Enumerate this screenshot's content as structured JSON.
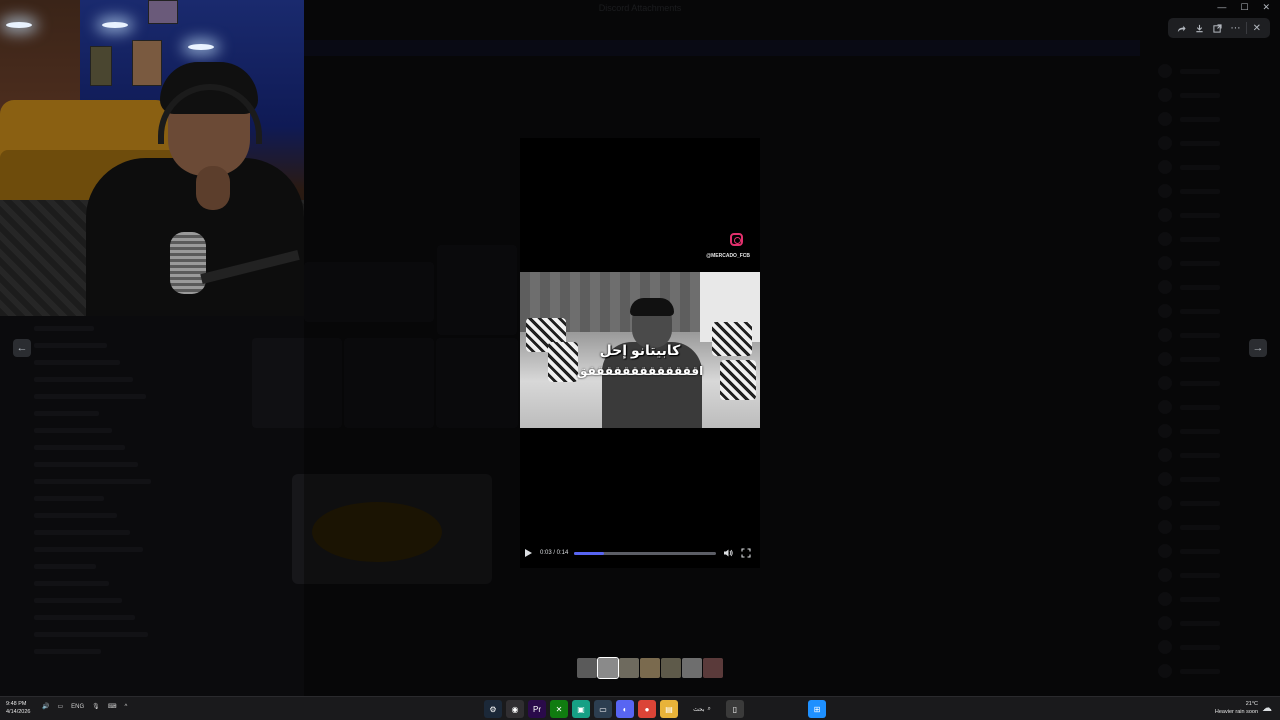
{
  "window": {
    "title": "Discord Attachments"
  },
  "viewer": {
    "actions": [
      "forward-icon",
      "download-icon",
      "open-in-browser-icon",
      "more-icon",
      "close-icon"
    ]
  },
  "video": {
    "ig_handle": "@MERCADO_FCB",
    "caption_line1": "كابيتانو إحل",
    "caption_line2": "اقققققققققققققق",
    "time": "0:03 / 0:14",
    "progress": 0.21
  },
  "thumbnails": {
    "colors": [
      "#5a5a5a",
      "#8a8a8a",
      "#6e6a5e",
      "#7a6a4e",
      "#5e5a4a",
      "#6e6e6e",
      "#5a3a3a"
    ],
    "selected_index": 1
  },
  "taskbar": {
    "time": "9:48 PM",
    "date": "4/14/2026",
    "lang": "ENG",
    "search_label": "بحث",
    "temperature": "21°C",
    "weather": "Heavier rain soon",
    "apps": [
      {
        "name": "steam-icon",
        "glyph": "⚙",
        "color": "#1b2838"
      },
      {
        "name": "obs-icon",
        "glyph": "◉",
        "color": "#302e31"
      },
      {
        "name": "premiere-icon",
        "glyph": "Pr",
        "color": "#2a0a4a"
      },
      {
        "name": "xbox-icon",
        "glyph": "✕",
        "color": "#107c10"
      },
      {
        "name": "spotify-like-icon",
        "glyph": "▣",
        "color": "#16a085"
      },
      {
        "name": "app-icon",
        "glyph": "▭",
        "color": "#2c3e50"
      },
      {
        "name": "discord-icon",
        "glyph": "◐",
        "color": "#5865f2"
      },
      {
        "name": "chrome-icon",
        "glyph": "●",
        "color": "#db4437"
      },
      {
        "name": "file-explorer-icon",
        "glyph": "▤",
        "color": "#e8b339"
      },
      {
        "name": "notepad-icon",
        "glyph": "▯",
        "color": "#3a3a3a"
      }
    ]
  }
}
